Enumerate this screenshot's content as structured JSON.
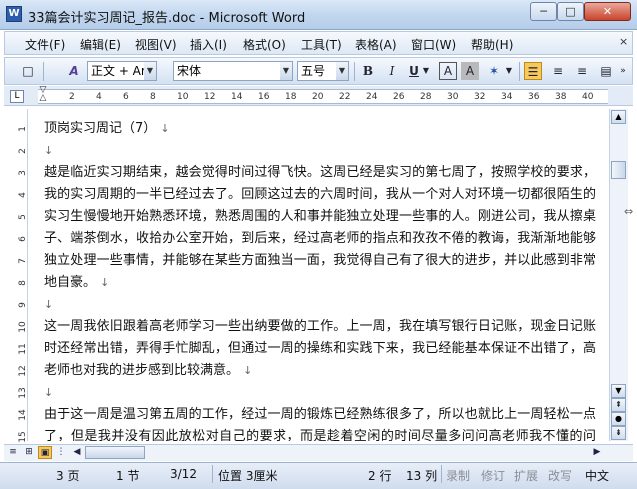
{
  "window": {
    "title": "33篇会计实习周记_报告.doc - Microsoft Word",
    "app_icon": "W",
    "buttons": {
      "minimize": "─",
      "maximize": "□",
      "close": "✕"
    }
  },
  "menubar": {
    "items": [
      "文件(F)",
      "编辑(E)",
      "视图(V)",
      "插入(I)",
      "格式(O)",
      "工具(T)",
      "表格(A)",
      "窗口(W)",
      "帮助(H)"
    ],
    "close_doc": "×"
  },
  "toolbar": {
    "style_value": "正文 + Aria",
    "font_value": "宋体",
    "size_value": "五号",
    "bold": "B",
    "italic": "I",
    "underline": "U",
    "char_border": "A",
    "char_shading": "A",
    "style_icon_text": "A",
    "new_icon": "□"
  },
  "ruler": {
    "corner": "L",
    "ticks": [
      "2",
      "4",
      "6",
      "8",
      "10",
      "12",
      "14",
      "16",
      "18",
      "20",
      "22",
      "24",
      "26",
      "28",
      "30",
      "32",
      "34",
      "36",
      "38",
      "40"
    ],
    "vticks": [
      "1",
      "2",
      "3",
      "4",
      "5",
      "6",
      "7",
      "8",
      "9",
      "10",
      "11",
      "12",
      "13",
      "14",
      "15"
    ]
  },
  "document": {
    "paragraphs": [
      "顶岗实习周记（7）",
      "",
      "越是临近实习期结束，越会觉得时间过得飞快。这周已经是实习的第七周了，按照学校的要求，我的实习周期的一半已经过去了。回顾这过去的六周时间，我从一个对人对环境一切都很陌生的实习生慢慢地开始熟悉环境，熟悉周围的人和事并能独立处理一些事的人。刚进公司，我从擦桌子、端茶倒水，收拾办公室开始，到后来，经过高老师的指点和孜孜不倦的教诲，我渐渐地能够独立处理一些事情，并能够在某些方面独当一面，我觉得自己有了很大的进步，并以此感到非常地自豪。",
      "",
      "这一周我依旧跟着高老师学习一些出纳要做的工作。上一周，我在填写银行日记账，现金日记账时还经常出错，弄得手忙脚乱，但通过一周的操练和实践下来，我已经能基本保证不出错了，高老师也对我的进步感到比较满意。",
      "",
      "由于这一周是温习第五周的工作，经过一周的锻炼已经熟练很多了，所以也就比上一周轻松一点了，但是我并没有因此放松对自己的要求，而是趁着空闲的时间尽量多问问高老师我不懂的问题，觉得时间过得很快，期待下一周我能有新的收获。"
    ],
    "para_mark": "↓"
  },
  "statusbar": {
    "page": "3 页",
    "section": "1 节",
    "page_of": "3/12",
    "position": "位置 3厘米",
    "line": "2 行",
    "column": "13 列",
    "rec": "录制",
    "trk": "修订",
    "ext": "扩展",
    "ovr": "改写",
    "language": "中文"
  }
}
